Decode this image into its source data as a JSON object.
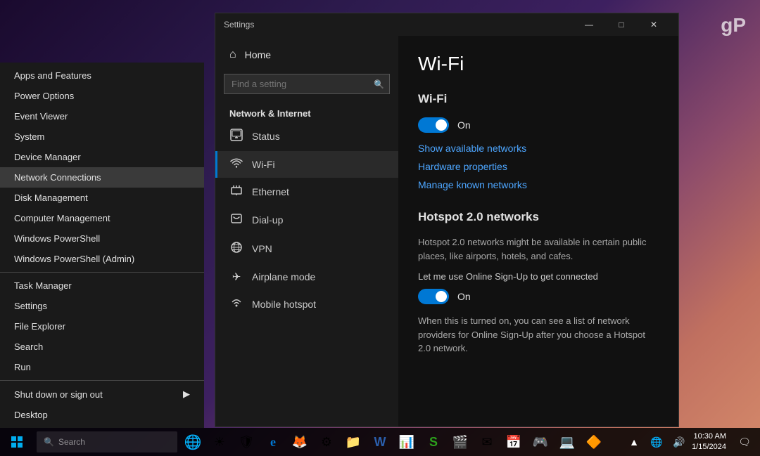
{
  "desktop": {
    "bg_class": "desktop-bg"
  },
  "gp_logo": "gP",
  "context_menu": {
    "items": [
      {
        "id": "apps-features",
        "label": "Apps and Features",
        "divider_after": false
      },
      {
        "id": "power-options",
        "label": "Power Options",
        "divider_after": false
      },
      {
        "id": "event-viewer",
        "label": "Event Viewer",
        "divider_after": false
      },
      {
        "id": "system",
        "label": "System",
        "divider_after": false
      },
      {
        "id": "device-manager",
        "label": "Device Manager",
        "divider_after": false
      },
      {
        "id": "network-connections",
        "label": "Network Connections",
        "highlighted": true,
        "divider_after": false
      },
      {
        "id": "disk-management",
        "label": "Disk Management",
        "divider_after": false
      },
      {
        "id": "computer-management",
        "label": "Computer Management",
        "divider_after": false
      },
      {
        "id": "windows-powershell",
        "label": "Windows PowerShell",
        "divider_after": false
      },
      {
        "id": "windows-powershell-admin",
        "label": "Windows PowerShell (Admin)",
        "divider_after": true
      }
    ],
    "items2": [
      {
        "id": "task-manager",
        "label": "Task Manager"
      },
      {
        "id": "settings",
        "label": "Settings"
      },
      {
        "id": "file-explorer",
        "label": "File Explorer"
      },
      {
        "id": "search",
        "label": "Search"
      },
      {
        "id": "run",
        "label": "Run"
      }
    ],
    "items3": [
      {
        "id": "shut-down",
        "label": "Shut down or sign out",
        "arrow": true
      },
      {
        "id": "desktop",
        "label": "Desktop"
      }
    ]
  },
  "settings_window": {
    "title": "Settings",
    "controls": {
      "minimize": "—",
      "maximize": "□",
      "close": "✕"
    },
    "sidebar": {
      "home_label": "Home",
      "search_placeholder": "Find a setting",
      "section_title": "Network & Internet",
      "nav_items": [
        {
          "id": "status",
          "label": "Status",
          "icon": "⊞"
        },
        {
          "id": "wifi",
          "label": "Wi-Fi",
          "icon": "((·))",
          "active": true
        },
        {
          "id": "ethernet",
          "label": "Ethernet",
          "icon": "⬜"
        },
        {
          "id": "dialup",
          "label": "Dial-up",
          "icon": "◯"
        },
        {
          "id": "vpn",
          "label": "VPN",
          "icon": "⊕"
        },
        {
          "id": "airplane",
          "label": "Airplane mode",
          "icon": "✈"
        },
        {
          "id": "hotspot",
          "label": "Mobile hotspot",
          "icon": "((·))"
        }
      ]
    },
    "content": {
      "title": "Wi-Fi",
      "wifi_section": {
        "heading": "Wi-Fi",
        "toggle_on": true,
        "toggle_label": "On",
        "link1": "Show available networks",
        "link2": "Hardware properties",
        "link3": "Manage known networks"
      },
      "hotspot_section": {
        "heading": "Hotspot 2.0 networks",
        "description": "Hotspot 2.0 networks might be available in certain public places, like airports, hotels, and cafes.",
        "toggle_label2": "Let me use Online Sign-Up to get connected",
        "toggle2_on": true,
        "toggle2_label": "On",
        "info": "When this is turned on, you can see a list of network providers for Online Sign-Up after you choose a Hotspot 2.0 network."
      }
    }
  },
  "taskbar": {
    "icons": [
      "🌐",
      "☀",
      "🛡",
      "e",
      "🦊",
      "⚙",
      "📁",
      "W",
      "📊",
      "S",
      "🎬",
      "✉",
      "📅",
      "🎮",
      "💻"
    ],
    "time": "10:30 AM",
    "date": "1/15/2024"
  }
}
